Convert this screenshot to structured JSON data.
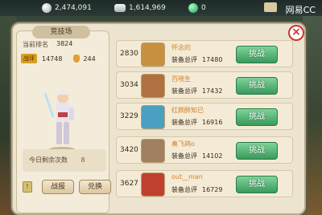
{
  "resources": {
    "silver": "2,474,091",
    "ingot": "1,614,969",
    "jade": "0"
  },
  "brand": "网易CC",
  "panel": {
    "title": "竞技场",
    "rank_label": "当前排名",
    "rank_value": "3824",
    "score_badge": "战评",
    "power": "14748",
    "gourd_count": "244",
    "remain_label": "今日剩余次数",
    "remain_value": "8",
    "info_label": "!",
    "battle_report_label": "战报",
    "exchange_label": "兑换"
  },
  "opponents": [
    {
      "rank": "2830",
      "name": "怀念的",
      "power_label": "装备总评",
      "power": "17480",
      "button": "挑战",
      "avatar_color": "#c89040"
    },
    {
      "rank": "3034",
      "name": "百晓生",
      "power_label": "装备总评",
      "power": "17432",
      "button": "挑战",
      "avatar_color": "#b07040"
    },
    {
      "rank": "3229",
      "name": "红颜醉知已",
      "power_label": "装备总评",
      "power": "16916",
      "button": "挑战",
      "avatar_color": "#4aa0c0"
    },
    {
      "rank": "3420",
      "name": "奏飞鸽o",
      "power_label": "装备总评",
      "power": "14102",
      "button": "挑战",
      "avatar_color": "#a08060"
    },
    {
      "rank": "3627",
      "name": "out__man",
      "power_label": "装备总评",
      "power": "16729",
      "button": "挑战",
      "avatar_color": "#c04030"
    }
  ]
}
